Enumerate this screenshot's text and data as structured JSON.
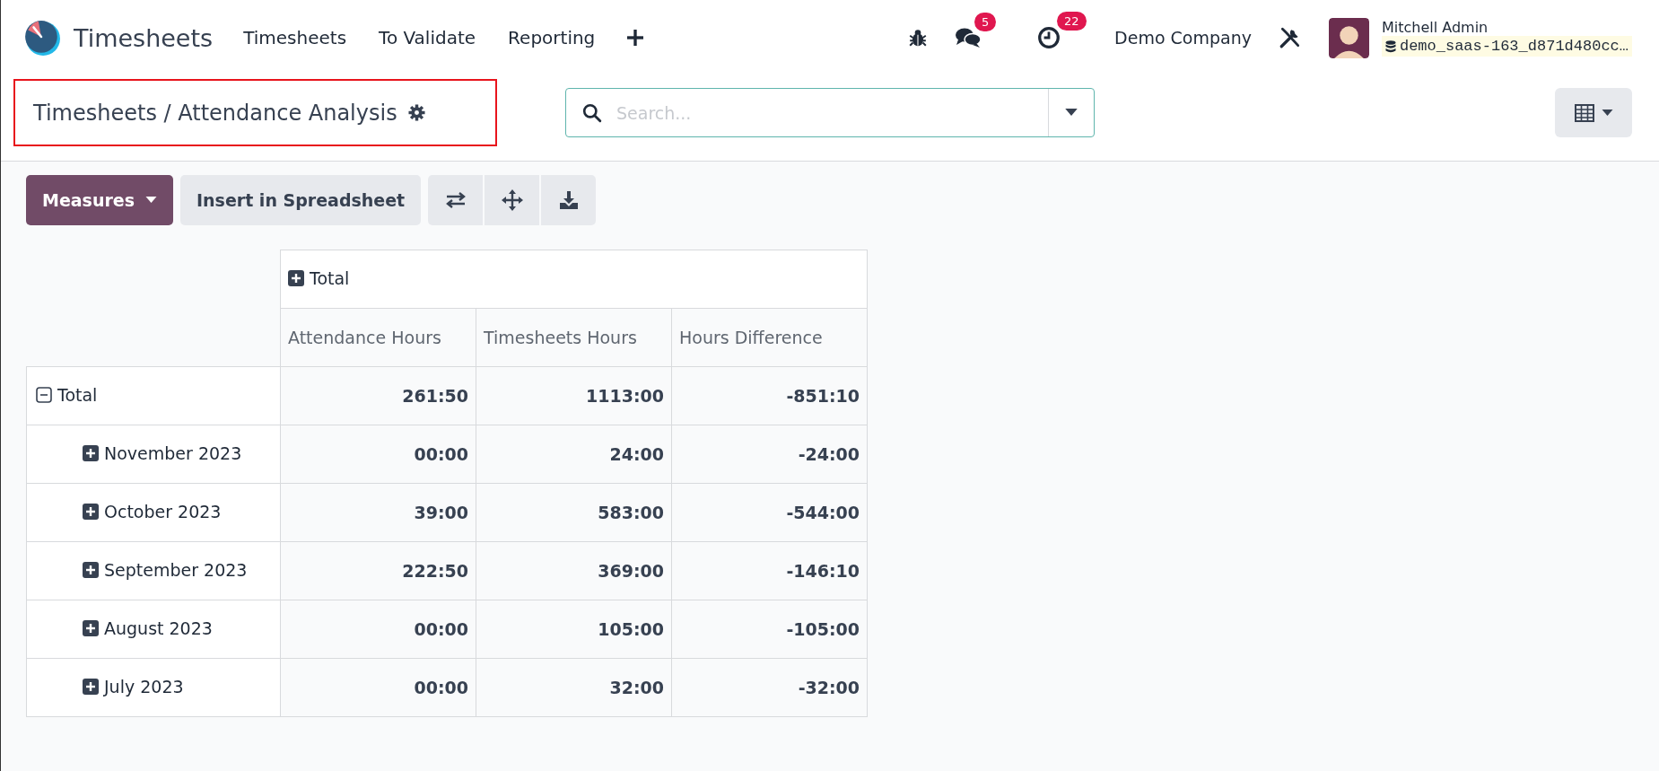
{
  "navbar": {
    "app_name": "Timesheets",
    "menu": [
      "Timesheets",
      "To Validate",
      "Reporting"
    ],
    "messages_count": "5",
    "activities_count": "22",
    "company": "Demo Company",
    "user": "Mitchell Admin",
    "database": "demo_saas-163_d871d480cc…"
  },
  "control_panel": {
    "breadcrumb": "Timesheets / Attendance Analysis",
    "search": {
      "placeholder": "Search..."
    }
  },
  "toolbar": {
    "measures_button": "Measures",
    "insert_button": "Insert in Spreadsheet"
  },
  "pivot": {
    "column_header": {
      "label": "Total",
      "expanded": false
    },
    "measures": [
      "Attendance Hours",
      "Timesheets Hours",
      "Hours Difference"
    ],
    "rows": [
      {
        "label": "Total",
        "expanded": true,
        "values": [
          "261:50",
          "1113:00",
          "-851:10"
        ],
        "children": [
          {
            "label": "November 2023",
            "expanded": false,
            "values": [
              "00:00",
              "24:00",
              "-24:00"
            ]
          },
          {
            "label": "October 2023",
            "expanded": false,
            "values": [
              "39:00",
              "583:00",
              "-544:00"
            ]
          },
          {
            "label": "September 2023",
            "expanded": false,
            "values": [
              "222:50",
              "369:00",
              "-146:10"
            ]
          },
          {
            "label": "August 2023",
            "expanded": false,
            "values": [
              "00:00",
              "105:00",
              "-105:00"
            ]
          },
          {
            "label": "July 2023",
            "expanded": false,
            "values": [
              "00:00",
              "32:00",
              "-32:00"
            ]
          }
        ]
      }
    ]
  }
}
